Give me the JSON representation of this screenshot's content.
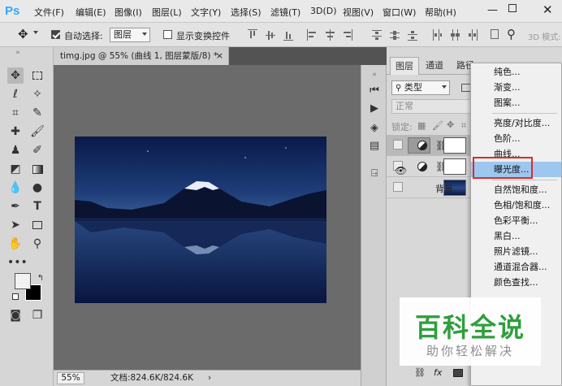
{
  "app": {
    "logo": "Ps",
    "menu": [
      "文件(F)",
      "编辑(E)",
      "图像(I)",
      "图层(L)",
      "文字(Y)",
      "选择(S)",
      "滤镜(T)",
      "3D(D)",
      "视图(V)",
      "窗口(W)",
      "帮助(H)"
    ]
  },
  "options": {
    "auto_select_label": "自动选择:",
    "auto_select_value": "图层",
    "show_transform_label": "显示变换控件",
    "mode_3d_label": "3D 模式:"
  },
  "document": {
    "tab_title": "timg.jpg @ 55% (曲线 1, 图层蒙版/8) *",
    "close_glyph": "×",
    "zoom": "55%",
    "doc_info": "文档:824.6K/824.6K",
    "status_arrow": "›"
  },
  "layers_panel": {
    "tabs": [
      "图层",
      "通道",
      "路径"
    ],
    "filter_label": "类型",
    "blend_mode": "正常",
    "lock_label": "锁定:",
    "layers": [
      {
        "name": "",
        "type": "adjustment"
      },
      {
        "name": "",
        "type": "adjustment"
      },
      {
        "name": "背景",
        "type": "image"
      }
    ],
    "bottom_fx": "fx"
  },
  "adjust_menu": {
    "items": [
      "纯色...",
      "渐变...",
      "图案...",
      "亮度/对比度...",
      "色阶...",
      "曲线...",
      "曝光度...",
      "自然饱和度...",
      "色相/饱和度...",
      "色彩平衡...",
      "黑白...",
      "照片滤镜...",
      "通道混合器...",
      "颜色查找..."
    ],
    "highlighted": "曝光度..."
  },
  "watermark": {
    "title": "百科全说",
    "subtitle": "助你轻松解决"
  },
  "colors": {
    "ps_blue": "#31a8ff",
    "highlight": "#9ec7ef",
    "red_box": "#e0282b",
    "watermark_green": "#2e9f3c"
  }
}
